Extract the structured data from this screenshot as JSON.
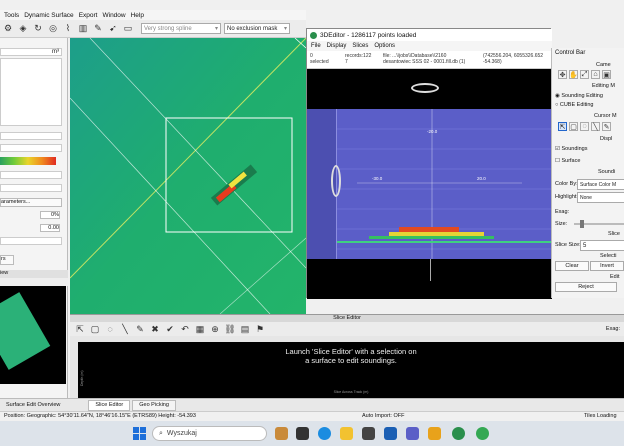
{
  "menubar": {
    "items": [
      "Tools",
      "Dynamic Surface",
      "Export",
      "Window",
      "Help"
    ]
  },
  "toolbar": {
    "filter_combo": "Very strong spline",
    "mask_combo": "No exclusion mask"
  },
  "left_panel": {
    "field1_suffix": "m³",
    "parameters_label": "arameters...",
    "value1": "0%",
    "value2": "0.00",
    "tab_label": "rs",
    "view_label": "iew",
    "bottom_tab": "Surface Edit Overview"
  },
  "editor3d": {
    "title": "3DEditor - 1286117 points loaded",
    "menu": [
      "File",
      "Display",
      "Slices",
      "Options"
    ],
    "info": {
      "col1": [
        "0",
        "selected"
      ],
      "col2": [
        "records:122",
        "7"
      ],
      "col3": [
        "file: ...\\\\jobs\\\\Database\\\\2160",
        "desantowiec SSS 02 - 0001.fill.db (1)"
      ],
      "col4": [
        "(742556.204, 6055326.652",
        "-54.368)"
      ]
    },
    "axis_labels": [
      "-20.0",
      "-30.0",
      "20.0"
    ]
  },
  "control_bar": {
    "title": "Control Bar",
    "camera_label": "Came",
    "editing_mode": "Editing M",
    "sounding_editing": "Sounding Editing",
    "cube_editing": "CUBE Editing",
    "cursor_mode": "Cursor M",
    "display_label": "Displ",
    "soundings_label": "Soundings",
    "surface_label": "Surface",
    "sounding_section": "Soundi",
    "color_by_label": "Color By:",
    "color_by_value": "Surface Color M",
    "highlight_label": "Highlight:",
    "highlight_value": "None",
    "exag_label": "Exag:",
    "size_label": "Size:",
    "slice_label": "Slice",
    "slice_size_label": "Slice Size:",
    "slice_size_value": "5",
    "selection_label": "Selecti",
    "clear_button": "Clear",
    "invert_button": "Invert",
    "edit_label": "Edit",
    "reject_button": "Reject"
  },
  "slice_editor": {
    "title": "Slice Editor",
    "exag_label": "Exag:",
    "message_line1": "Launch 'Slice Editor' with a selection on",
    "message_line2": "a surface to edit soundings.",
    "x_axis_label": "Slice Across Track (m)",
    "y_axis_label": "Depth (m)"
  },
  "tabs": [
    "Slice Editor",
    "Geo Picking"
  ],
  "status": {
    "position": "Position: Geographic: 54°30'11.64\"N, 18°46'16.15\"E (ETRS89)   Height: -54.393",
    "auto_import": "Auto Import: OFF",
    "tiles": "Tiles Loading"
  },
  "taskbar": {
    "search_placeholder": "Wyszukaj"
  },
  "colors": {
    "surface": "#1fa577",
    "editor_bg": "#5b5ec8",
    "accent": "#2266cc"
  }
}
